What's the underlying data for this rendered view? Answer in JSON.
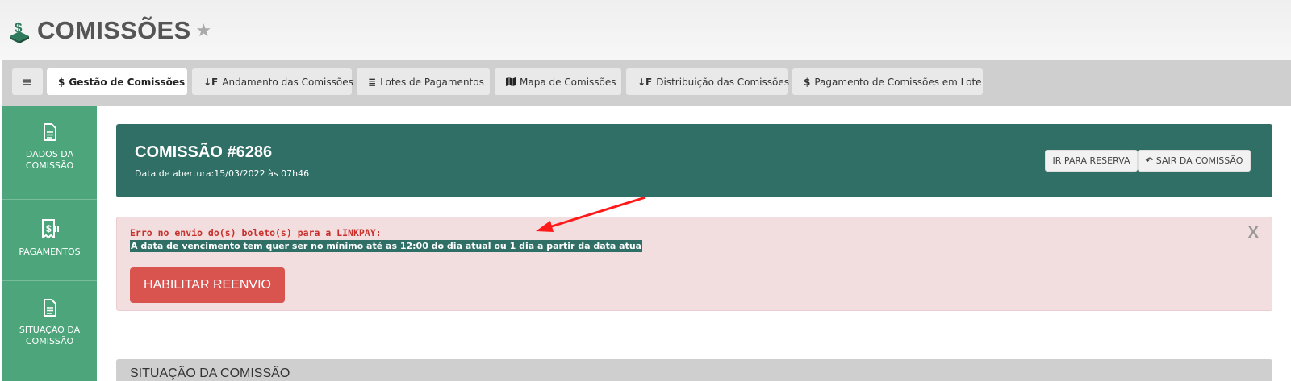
{
  "header": {
    "title": "COMISSÕES",
    "icon": "money-stack-icon",
    "favorite_icon": "star-icon"
  },
  "tabs": [
    {
      "icon": "$",
      "label": "Gestão de Comissões",
      "active": true
    },
    {
      "icon": "↓F",
      "label": "Andamento das Comissões",
      "active": false
    },
    {
      "icon": "≣",
      "label": "Lotes de Pagamentos",
      "active": false
    },
    {
      "icon": "map-icon",
      "label": "Mapa de Comissões",
      "active": false
    },
    {
      "icon": "↓F",
      "label": "Distribuição das Comissões",
      "active": false
    },
    {
      "icon": "$",
      "label": "Pagamento de Comissões em Lote",
      "active": false
    }
  ],
  "menu_button": {
    "icon": "≡"
  },
  "sidebar": {
    "items": [
      {
        "label": "DADOS DA COMISSÃO",
        "icon": "document-icon"
      },
      {
        "label": "PAGAMENTOS",
        "icon": "receipt-dollar-icon"
      },
      {
        "label": "SITUAÇÃO DA COMISSÃO",
        "icon": "document-icon"
      }
    ]
  },
  "commission": {
    "title": "COMISSÃO #6286",
    "opening_label": "Data de abertura:15/03/2022 às 07h46",
    "goto_reservation": "IR PARA RESERVA",
    "exit_label": "SAIR DA COMISSÃO"
  },
  "error": {
    "title": "Erro no envio do(s) boleto(s) para a LINKPAY:",
    "message": "A data de vencimento tem quer ser no mínimo até as 12:00 do dia atual ou 1 dia a partir da data atua",
    "close": "X",
    "resend_button": "HABILITAR REENVIO"
  },
  "situation": {
    "title": "SITUAÇÃO DA COMISSÃO"
  },
  "colors": {
    "banner": "#2f6f65",
    "sidebar": "#4da67b",
    "error_bg": "#f2dede",
    "danger": "#d9534f",
    "annotation_arrow": "#ff1a1a"
  }
}
